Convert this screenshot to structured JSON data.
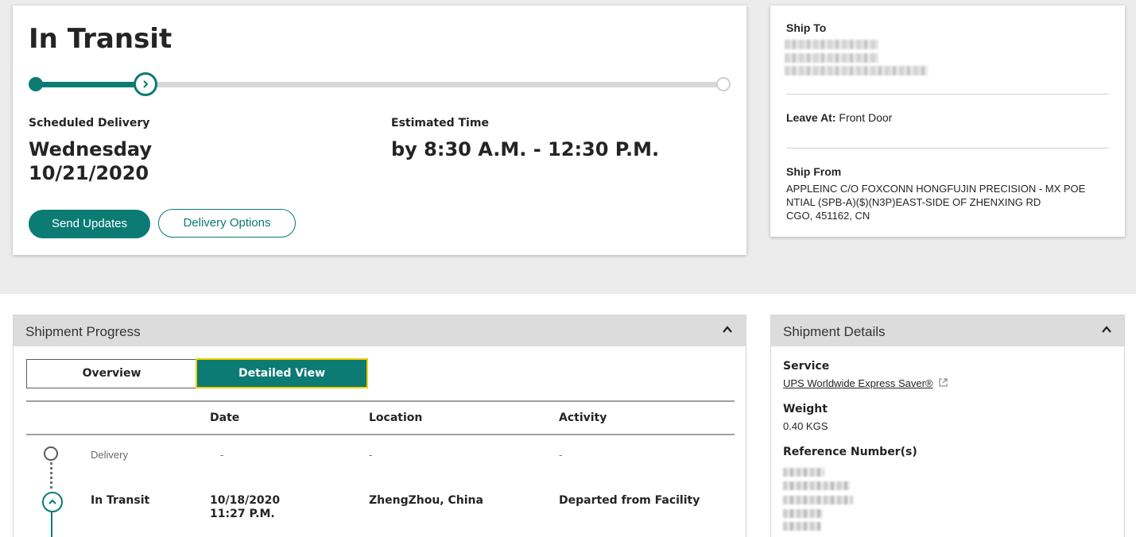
{
  "status": {
    "title": "In Transit",
    "progress_fraction": 0.16,
    "scheduled_label": "Scheduled Delivery",
    "scheduled_day": "Wednesday",
    "scheduled_date": "10/21/2020",
    "estimated_label": "Estimated Time",
    "estimated_time": "by 8:30 A.M. - 12:30 P.M.",
    "send_updates_label": "Send Updates",
    "delivery_options_label": "Delivery Options"
  },
  "ship": {
    "to_label": "Ship To",
    "leave_at_label": "Leave At:",
    "leave_at_value": "Front Door",
    "from_label": "Ship From",
    "from_lines": [
      "APPLEINC C/O FOXCONN HONGFUJIN PRECISION - MX POE",
      "NTIAL (SPB-A)($)(N3P)EAST-SIDE OF ZHENXING RD",
      "CGO, 451162, CN"
    ]
  },
  "progress_panel": {
    "title": "Shipment Progress",
    "tabs": [
      "Overview",
      "Detailed View"
    ],
    "columns": [
      "Date",
      "Location",
      "Activity"
    ],
    "rows": [
      {
        "status": "Delivery",
        "date": "-",
        "date2": "",
        "location": "-",
        "activity": "-"
      },
      {
        "status": "In Transit",
        "date": "10/18/2020",
        "date2": "11:27 P.M.",
        "location": "ZhengZhou, China",
        "activity": "Departed from Facility"
      }
    ]
  },
  "details_panel": {
    "title": "Shipment Details",
    "service_label": "Service",
    "service_value": "UPS Worldwide Express Saver®",
    "weight_label": "Weight",
    "weight_value": "0.40 KGS",
    "reference_label": "Reference Number(s)"
  },
  "colors": {
    "accent": "#0b7b74",
    "focus": "#f2cf00",
    "panel_header": "#dcdcdc"
  },
  "icons": [
    "chevron-right-icon",
    "chevron-up-icon",
    "external-link-icon"
  ]
}
